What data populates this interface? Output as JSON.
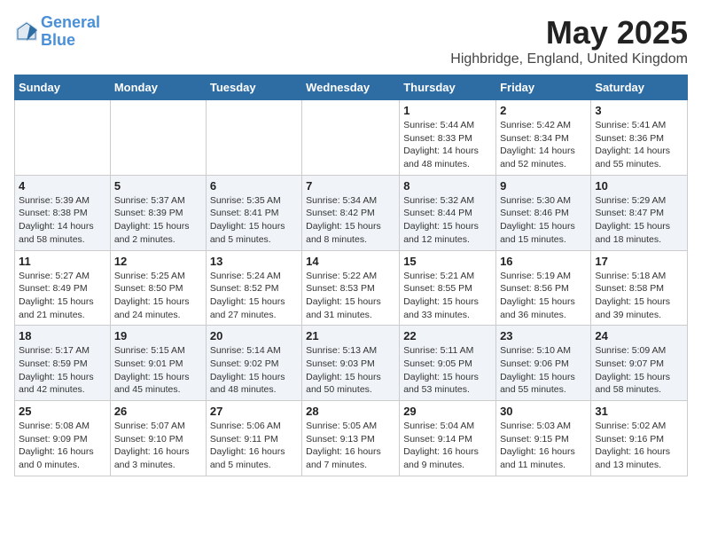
{
  "logo": {
    "line1": "General",
    "line2": "Blue"
  },
  "title": "May 2025",
  "subtitle": "Highbridge, England, United Kingdom",
  "days_of_week": [
    "Sunday",
    "Monday",
    "Tuesday",
    "Wednesday",
    "Thursday",
    "Friday",
    "Saturday"
  ],
  "weeks": [
    [
      {
        "day": "",
        "detail": ""
      },
      {
        "day": "",
        "detail": ""
      },
      {
        "day": "",
        "detail": ""
      },
      {
        "day": "",
        "detail": ""
      },
      {
        "day": "1",
        "detail": "Sunrise: 5:44 AM\nSunset: 8:33 PM\nDaylight: 14 hours\nand 48 minutes."
      },
      {
        "day": "2",
        "detail": "Sunrise: 5:42 AM\nSunset: 8:34 PM\nDaylight: 14 hours\nand 52 minutes."
      },
      {
        "day": "3",
        "detail": "Sunrise: 5:41 AM\nSunset: 8:36 PM\nDaylight: 14 hours\nand 55 minutes."
      }
    ],
    [
      {
        "day": "4",
        "detail": "Sunrise: 5:39 AM\nSunset: 8:38 PM\nDaylight: 14 hours\nand 58 minutes."
      },
      {
        "day": "5",
        "detail": "Sunrise: 5:37 AM\nSunset: 8:39 PM\nDaylight: 15 hours\nand 2 minutes."
      },
      {
        "day": "6",
        "detail": "Sunrise: 5:35 AM\nSunset: 8:41 PM\nDaylight: 15 hours\nand 5 minutes."
      },
      {
        "day": "7",
        "detail": "Sunrise: 5:34 AM\nSunset: 8:42 PM\nDaylight: 15 hours\nand 8 minutes."
      },
      {
        "day": "8",
        "detail": "Sunrise: 5:32 AM\nSunset: 8:44 PM\nDaylight: 15 hours\nand 12 minutes."
      },
      {
        "day": "9",
        "detail": "Sunrise: 5:30 AM\nSunset: 8:46 PM\nDaylight: 15 hours\nand 15 minutes."
      },
      {
        "day": "10",
        "detail": "Sunrise: 5:29 AM\nSunset: 8:47 PM\nDaylight: 15 hours\nand 18 minutes."
      }
    ],
    [
      {
        "day": "11",
        "detail": "Sunrise: 5:27 AM\nSunset: 8:49 PM\nDaylight: 15 hours\nand 21 minutes."
      },
      {
        "day": "12",
        "detail": "Sunrise: 5:25 AM\nSunset: 8:50 PM\nDaylight: 15 hours\nand 24 minutes."
      },
      {
        "day": "13",
        "detail": "Sunrise: 5:24 AM\nSunset: 8:52 PM\nDaylight: 15 hours\nand 27 minutes."
      },
      {
        "day": "14",
        "detail": "Sunrise: 5:22 AM\nSunset: 8:53 PM\nDaylight: 15 hours\nand 31 minutes."
      },
      {
        "day": "15",
        "detail": "Sunrise: 5:21 AM\nSunset: 8:55 PM\nDaylight: 15 hours\nand 33 minutes."
      },
      {
        "day": "16",
        "detail": "Sunrise: 5:19 AM\nSunset: 8:56 PM\nDaylight: 15 hours\nand 36 minutes."
      },
      {
        "day": "17",
        "detail": "Sunrise: 5:18 AM\nSunset: 8:58 PM\nDaylight: 15 hours\nand 39 minutes."
      }
    ],
    [
      {
        "day": "18",
        "detail": "Sunrise: 5:17 AM\nSunset: 8:59 PM\nDaylight: 15 hours\nand 42 minutes."
      },
      {
        "day": "19",
        "detail": "Sunrise: 5:15 AM\nSunset: 9:01 PM\nDaylight: 15 hours\nand 45 minutes."
      },
      {
        "day": "20",
        "detail": "Sunrise: 5:14 AM\nSunset: 9:02 PM\nDaylight: 15 hours\nand 48 minutes."
      },
      {
        "day": "21",
        "detail": "Sunrise: 5:13 AM\nSunset: 9:03 PM\nDaylight: 15 hours\nand 50 minutes."
      },
      {
        "day": "22",
        "detail": "Sunrise: 5:11 AM\nSunset: 9:05 PM\nDaylight: 15 hours\nand 53 minutes."
      },
      {
        "day": "23",
        "detail": "Sunrise: 5:10 AM\nSunset: 9:06 PM\nDaylight: 15 hours\nand 55 minutes."
      },
      {
        "day": "24",
        "detail": "Sunrise: 5:09 AM\nSunset: 9:07 PM\nDaylight: 15 hours\nand 58 minutes."
      }
    ],
    [
      {
        "day": "25",
        "detail": "Sunrise: 5:08 AM\nSunset: 9:09 PM\nDaylight: 16 hours\nand 0 minutes."
      },
      {
        "day": "26",
        "detail": "Sunrise: 5:07 AM\nSunset: 9:10 PM\nDaylight: 16 hours\nand 3 minutes."
      },
      {
        "day": "27",
        "detail": "Sunrise: 5:06 AM\nSunset: 9:11 PM\nDaylight: 16 hours\nand 5 minutes."
      },
      {
        "day": "28",
        "detail": "Sunrise: 5:05 AM\nSunset: 9:13 PM\nDaylight: 16 hours\nand 7 minutes."
      },
      {
        "day": "29",
        "detail": "Sunrise: 5:04 AM\nSunset: 9:14 PM\nDaylight: 16 hours\nand 9 minutes."
      },
      {
        "day": "30",
        "detail": "Sunrise: 5:03 AM\nSunset: 9:15 PM\nDaylight: 16 hours\nand 11 minutes."
      },
      {
        "day": "31",
        "detail": "Sunrise: 5:02 AM\nSunset: 9:16 PM\nDaylight: 16 hours\nand 13 minutes."
      }
    ]
  ]
}
